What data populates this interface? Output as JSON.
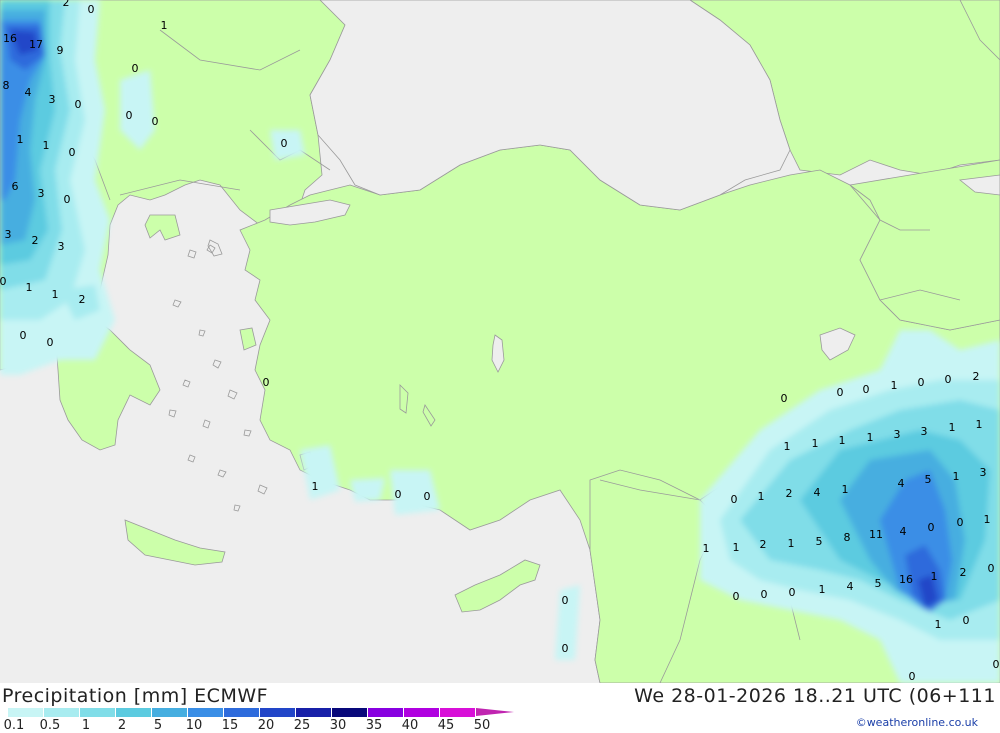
{
  "header": {
    "title": "Precipitation [mm] ECMWF",
    "datetime": "We 28-01-2026 18..21 UTC (06+111",
    "credit": "©weatheronline.co.uk"
  },
  "legend": {
    "ticks": [
      "0.1",
      "0.5",
      "1",
      "2",
      "5",
      "10",
      "15",
      "20",
      "25",
      "30",
      "35",
      "40",
      "45",
      "50"
    ],
    "colors": [
      "#c8f5f5",
      "#a8ecf0",
      "#80dde8",
      "#5ccbe0",
      "#46aee0",
      "#3a8ee6",
      "#2e6bdc",
      "#2246c8",
      "#1820a8",
      "#08087a",
      "#8800e0",
      "#b000e0",
      "#d810d8",
      "#c025b0"
    ]
  },
  "map": {
    "colors": {
      "sea": "#eeeeee",
      "land": "#ccffaa",
      "border": "#9a9a9a"
    },
    "labels": [
      "2",
      "0",
      "16",
      "17",
      "9",
      "8",
      "4",
      "3",
      "0",
      "1",
      "1",
      "0",
      "6",
      "3",
      "0",
      "3",
      "2",
      "3",
      "0",
      "1",
      "1",
      "2",
      "0",
      "0",
      "1",
      "0",
      "0",
      "0",
      "0",
      "0",
      "0",
      "1",
      "0",
      "0",
      "0",
      "0",
      "0",
      "0",
      "1",
      "0",
      "0",
      "1",
      "1",
      "1",
      "1",
      "3",
      "3",
      "1",
      "1",
      "0",
      "1",
      "2",
      "4",
      "1",
      "4",
      "5",
      "1",
      "3",
      "0",
      "1",
      "1",
      "2",
      "1",
      "5",
      "8",
      "11",
      "4",
      "0",
      "1",
      "1",
      "4",
      "5",
      "16",
      "1",
      "2",
      "0",
      "0",
      "0",
      "0",
      "1",
      "0",
      "2",
      "0",
      "0",
      "0"
    ]
  }
}
